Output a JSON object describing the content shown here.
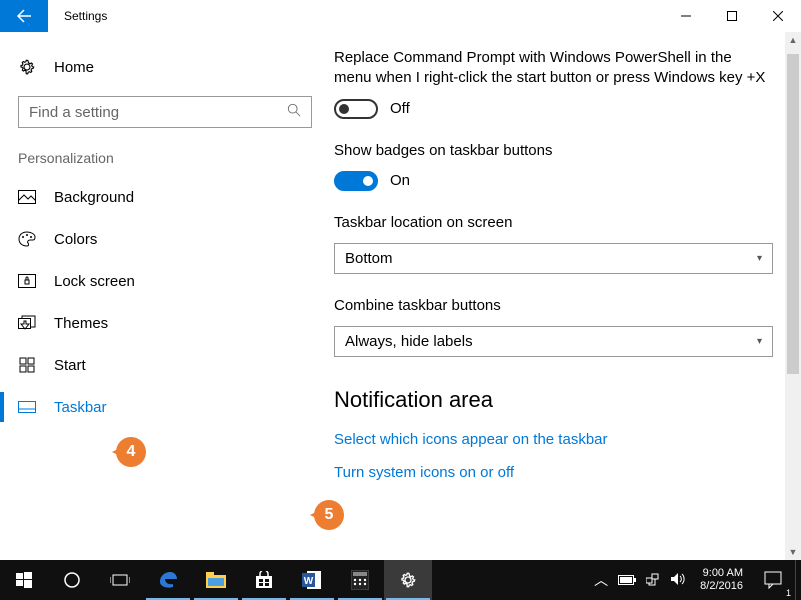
{
  "titlebar": {
    "title": "Settings"
  },
  "sidebar": {
    "home": "Home",
    "search_placeholder": "Find a setting",
    "category": "Personalization",
    "items": [
      {
        "label": "Background"
      },
      {
        "label": "Colors"
      },
      {
        "label": "Lock screen"
      },
      {
        "label": "Themes"
      },
      {
        "label": "Start"
      },
      {
        "label": "Taskbar"
      }
    ]
  },
  "content": {
    "powershell_desc": "Replace Command Prompt with Windows PowerShell in the menu when I right-click the start button or press Windows key +X",
    "powershell_state": "Off",
    "badges_desc": "Show badges on taskbar buttons",
    "badges_state": "On",
    "location_label": "Taskbar location on screen",
    "location_value": "Bottom",
    "combine_label": "Combine taskbar buttons",
    "combine_value": "Always, hide labels",
    "notification_heading": "Notification area",
    "link1": "Select which icons appear on the taskbar",
    "link2": "Turn system icons on or off"
  },
  "annotations": {
    "b4": "4",
    "b5": "5"
  },
  "taskbar": {
    "time": "9:00 AM",
    "date": "8/2/2016",
    "action_center_count": "1"
  }
}
